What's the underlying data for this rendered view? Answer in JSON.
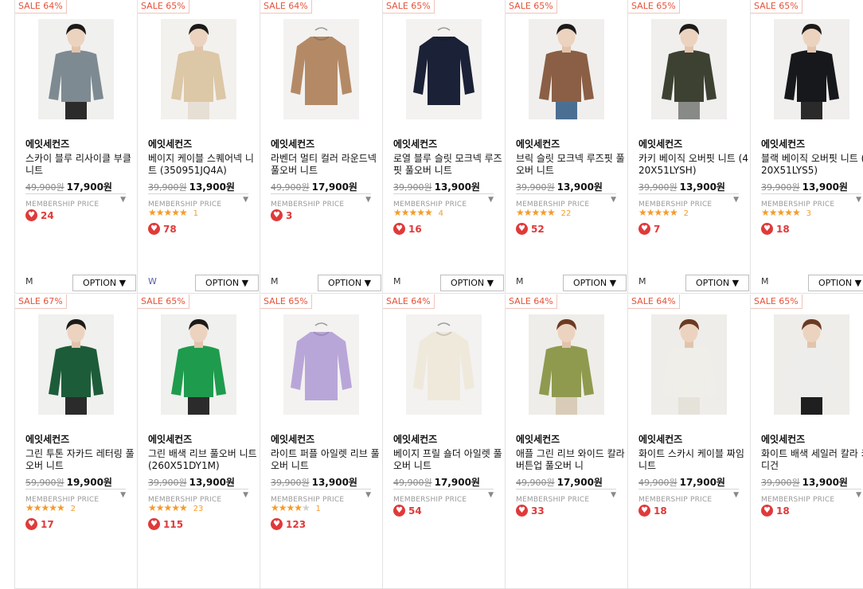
{
  "colors": {
    "sale": "#e5523a",
    "heart": "#e03a3a",
    "star": "#f59b28"
  },
  "membership_label": "MEMBERSHIP PRICE",
  "option_label": "OPTION ▼",
  "products": [
    {
      "sale": "SALE 64%",
      "brand": "에잇세컨즈",
      "name": "스카이 블루 리사이클 부클 니트",
      "orig": "49,900원",
      "price": "17,900원",
      "stars": 0,
      "reviews": "",
      "likes": "24",
      "size": "M",
      "img": "model",
      "garment": "#7e8a92",
      "hair": "#1c1a19",
      "bottom": "#2b2b2b",
      "bg": "#f0f0ee"
    },
    {
      "sale": "SALE 65%",
      "brand": "에잇세컨즈",
      "name": "베이지 케이블 스퀘어넥 니트 (350951JQ4A)",
      "orig": "39,900원",
      "price": "13,900원",
      "stars": 5,
      "reviews": "1",
      "likes": "78",
      "size": "W",
      "img": "model",
      "garment": "#dcc7a6",
      "hair": "#1c1a19",
      "bottom": "#e6dfd4",
      "bg": "#f2f1ee"
    },
    {
      "sale": "SALE 64%",
      "brand": "에잇세컨즈",
      "name": "라벤더 멀티 컬러 라운드넥 풀오버 니트",
      "orig": "49,900원",
      "price": "17,900원",
      "stars": 0,
      "reviews": "",
      "likes": "3",
      "size": "M",
      "img": "flat",
      "garment": "#b48a66",
      "hair": "#000",
      "bottom": "#000",
      "bg": "#f3f2f0"
    },
    {
      "sale": "SALE 65%",
      "brand": "에잇세컨즈",
      "name": "로열 블루 슬릿 모크넥 루즈핏 풀오버 니트",
      "orig": "39,900원",
      "price": "13,900원",
      "stars": 5,
      "reviews": "4",
      "likes": "16",
      "size": "M",
      "img": "flat",
      "garment": "#1b2136",
      "hair": "#000",
      "bottom": "#000",
      "bg": "#f3f2f0"
    },
    {
      "sale": "SALE 65%",
      "brand": "에잇세컨즈",
      "name": "브릭 슬릿 모크넥 루즈핏 풀오버 니트",
      "orig": "39,900원",
      "price": "13,900원",
      "stars": 5,
      "reviews": "22",
      "likes": "52",
      "size": "M",
      "img": "model",
      "garment": "#8a5f45",
      "hair": "#1c1a19",
      "bottom": "#4b6f92",
      "bg": "#f0efed"
    },
    {
      "sale": "SALE 65%",
      "brand": "에잇세컨즈",
      "name": "카키 베이직 오버핏 니트 (420X51LYSH)",
      "orig": "39,900원",
      "price": "13,900원",
      "stars": 5,
      "reviews": "2",
      "likes": "7",
      "size": "M",
      "img": "model",
      "garment": "#3d4132",
      "hair": "#1c1a19",
      "bottom": "#888a88",
      "bg": "#f0efed"
    },
    {
      "sale": "SALE 65%",
      "brand": "에잇세컨즈",
      "name": "블랙 베이직 오버핏 니트 (420X51LYS5)",
      "orig": "39,900원",
      "price": "13,900원",
      "stars": 5,
      "reviews": "3",
      "likes": "18",
      "size": "M",
      "img": "model",
      "garment": "#17181c",
      "hair": "#1c1a19",
      "bottom": "#2a2a2a",
      "bg": "#f0efed"
    },
    {
      "sale": "SALE 67%",
      "brand": "에잇세컨즈",
      "name": "그린 투톤 자카드 레터링 풀오버 니트",
      "orig": "59,900원",
      "price": "19,900원",
      "stars": 5,
      "reviews": "2",
      "likes": "17",
      "size": "",
      "img": "model",
      "garment": "#1d5c39",
      "hair": "#1c1a19",
      "bottom": "#2b2b2b",
      "bg": "#f0f0ee"
    },
    {
      "sale": "SALE 65%",
      "brand": "에잇세컨즈",
      "name": "그린 배색 리브 풀오버 니트 (260X51DY1M)",
      "orig": "39,900원",
      "price": "13,900원",
      "stars": 5,
      "reviews": "23",
      "likes": "115",
      "size": "",
      "img": "model",
      "garment": "#1f9b4d",
      "hair": "#1c1a19",
      "bottom": "#2b2b2b",
      "bg": "#f0f0ee"
    },
    {
      "sale": "SALE 65%",
      "brand": "에잇세컨즈",
      "name": "라이트 퍼플 아일렛 리브 풀오버 니트",
      "orig": "39,900원",
      "price": "13,900원",
      "stars": 4,
      "reviews": "1",
      "likes": "123",
      "size": "",
      "img": "flat",
      "garment": "#b9a6d8",
      "hair": "#000",
      "bottom": "#000",
      "bg": "#f3f2f0"
    },
    {
      "sale": "SALE 64%",
      "brand": "에잇세컨즈",
      "name": "베이지 프릴 숄더 아일렛 풀오버 니트",
      "orig": "49,900원",
      "price": "17,900원",
      "stars": 0,
      "reviews": "",
      "likes": "54",
      "size": "",
      "img": "flat",
      "garment": "#efe9dc",
      "hair": "#000",
      "bottom": "#000",
      "bg": "#f3f2f0"
    },
    {
      "sale": "SALE 64%",
      "brand": "에잇세컨즈",
      "name": "애플 그린 리브 와이드 칼라 버튼업 풀오버 니",
      "orig": "49,900원",
      "price": "17,900원",
      "stars": 0,
      "reviews": "",
      "likes": "33",
      "size": "",
      "img": "model",
      "garment": "#8f9a4f",
      "hair": "#6b3a22",
      "bottom": "#d8ccb8",
      "bg": "#efede9"
    },
    {
      "sale": "SALE 64%",
      "brand": "에잇세컨즈",
      "name": "화이트 스카시 케이블 짜임 니트",
      "orig": "49,900원",
      "price": "17,900원",
      "stars": 0,
      "reviews": "",
      "likes": "18",
      "size": "",
      "img": "model",
      "garment": "#efeee8",
      "hair": "#6b3a22",
      "bottom": "#e5e2da",
      "bg": "#efede9"
    },
    {
      "sale": "SALE 65%",
      "brand": "에잇세컨즈",
      "name": "화이트 배색 세일러 칼라 카디건",
      "orig": "39,900원",
      "price": "13,900원",
      "stars": 0,
      "reviews": "",
      "likes": "18",
      "size": "",
      "img": "model",
      "garment": "#ededeb",
      "hair": "#6b3a22",
      "bottom": "#1f1f1f",
      "bg": "#efede9"
    }
  ]
}
